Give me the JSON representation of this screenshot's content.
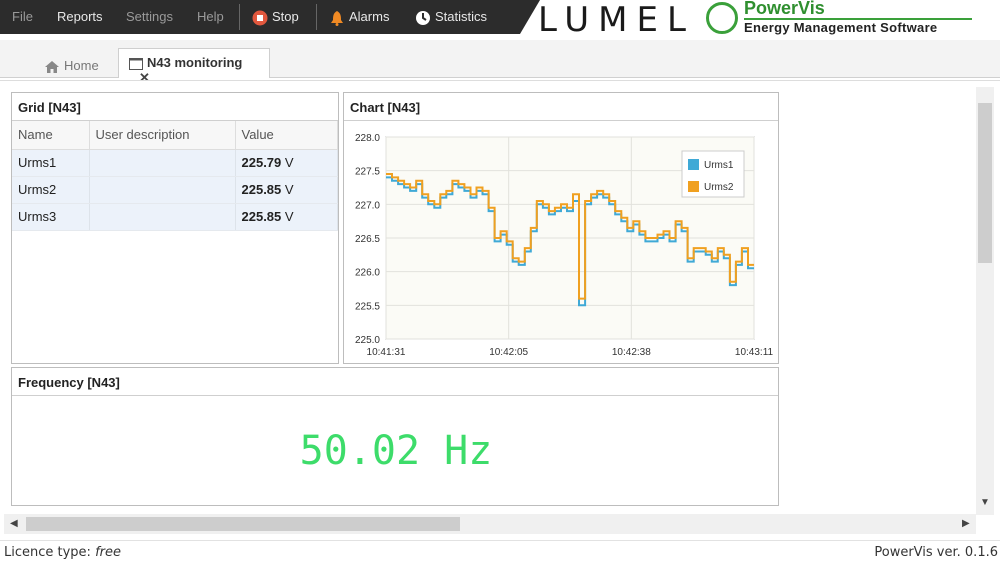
{
  "menu": {
    "file": "File",
    "reports": "Reports",
    "settings": "Settings",
    "help": "Help",
    "stop": "Stop",
    "alarms": "Alarms",
    "statistics": "Statistics"
  },
  "brand": {
    "lumel": "LUMEL",
    "product": "PowerVis",
    "subtitle": "Energy Management Software"
  },
  "tabs": {
    "home": "Home",
    "active": "N43 monitoring",
    "close": "✕"
  },
  "grid": {
    "title": "Grid [N43]",
    "columns": [
      "Name",
      "User description",
      "Value"
    ],
    "rows": [
      {
        "name": "Urms1",
        "desc": "",
        "value": "225.79",
        "unit": "V"
      },
      {
        "name": "Urms2",
        "desc": "",
        "value": "225.85",
        "unit": "V"
      },
      {
        "name": "Urms3",
        "desc": "",
        "value": "225.85",
        "unit": "V"
      }
    ]
  },
  "chart_panel": {
    "title": "Chart [N43]"
  },
  "chart_data": {
    "type": "line",
    "title": "",
    "xlabel": "",
    "ylabel": "",
    "x_ticks": [
      "10:41:31",
      "10:42:05",
      "10:42:38",
      "10:43:11"
    ],
    "y_ticks": [
      "228.0",
      "227.5",
      "227.0",
      "226.5",
      "226.0",
      "225.5",
      "225.0"
    ],
    "ylim": [
      225.0,
      228.0
    ],
    "grid": true,
    "legend_position": "top-right",
    "series": [
      {
        "name": "Urms1",
        "color": "#3fa9d6",
        "values": [
          227.4,
          227.35,
          227.3,
          227.25,
          227.2,
          227.3,
          227.1,
          227.0,
          226.95,
          227.1,
          227.15,
          227.3,
          227.25,
          227.2,
          227.1,
          227.2,
          227.15,
          226.9,
          226.45,
          226.55,
          226.4,
          226.15,
          226.1,
          226.3,
          226.6,
          227.0,
          226.95,
          226.85,
          226.9,
          226.95,
          226.9,
          227.05,
          225.5,
          227.0,
          227.1,
          227.15,
          227.1,
          227.0,
          226.85,
          226.75,
          226.6,
          226.7,
          226.55,
          226.45,
          226.45,
          226.5,
          226.55,
          226.45,
          226.7,
          226.6,
          226.15,
          226.3,
          226.3,
          226.25,
          226.15,
          226.3,
          226.2,
          225.8,
          226.1,
          226.3,
          226.05
        ]
      },
      {
        "name": "Urms2",
        "color": "#f0a020",
        "values": [
          227.45,
          227.4,
          227.35,
          227.3,
          227.25,
          227.35,
          227.15,
          227.05,
          227.0,
          227.15,
          227.2,
          227.35,
          227.3,
          227.25,
          227.15,
          227.25,
          227.2,
          226.95,
          226.5,
          226.6,
          226.45,
          226.2,
          226.15,
          226.35,
          226.65,
          227.05,
          227.0,
          226.9,
          226.95,
          227.0,
          226.95,
          227.15,
          225.6,
          227.05,
          227.15,
          227.2,
          227.15,
          227.05,
          226.9,
          226.8,
          226.65,
          226.75,
          226.6,
          226.5,
          226.5,
          226.55,
          226.6,
          226.5,
          226.75,
          226.65,
          226.2,
          226.35,
          226.35,
          226.3,
          226.2,
          226.35,
          226.25,
          225.85,
          226.15,
          226.35,
          226.1
        ]
      }
    ]
  },
  "frequency": {
    "title": "Frequency [N43]",
    "value": "50.02 Hz"
  },
  "status": {
    "licence_label": "Licence type:",
    "licence_value": "free",
    "version": "PowerVis ver. 0.1.6"
  }
}
